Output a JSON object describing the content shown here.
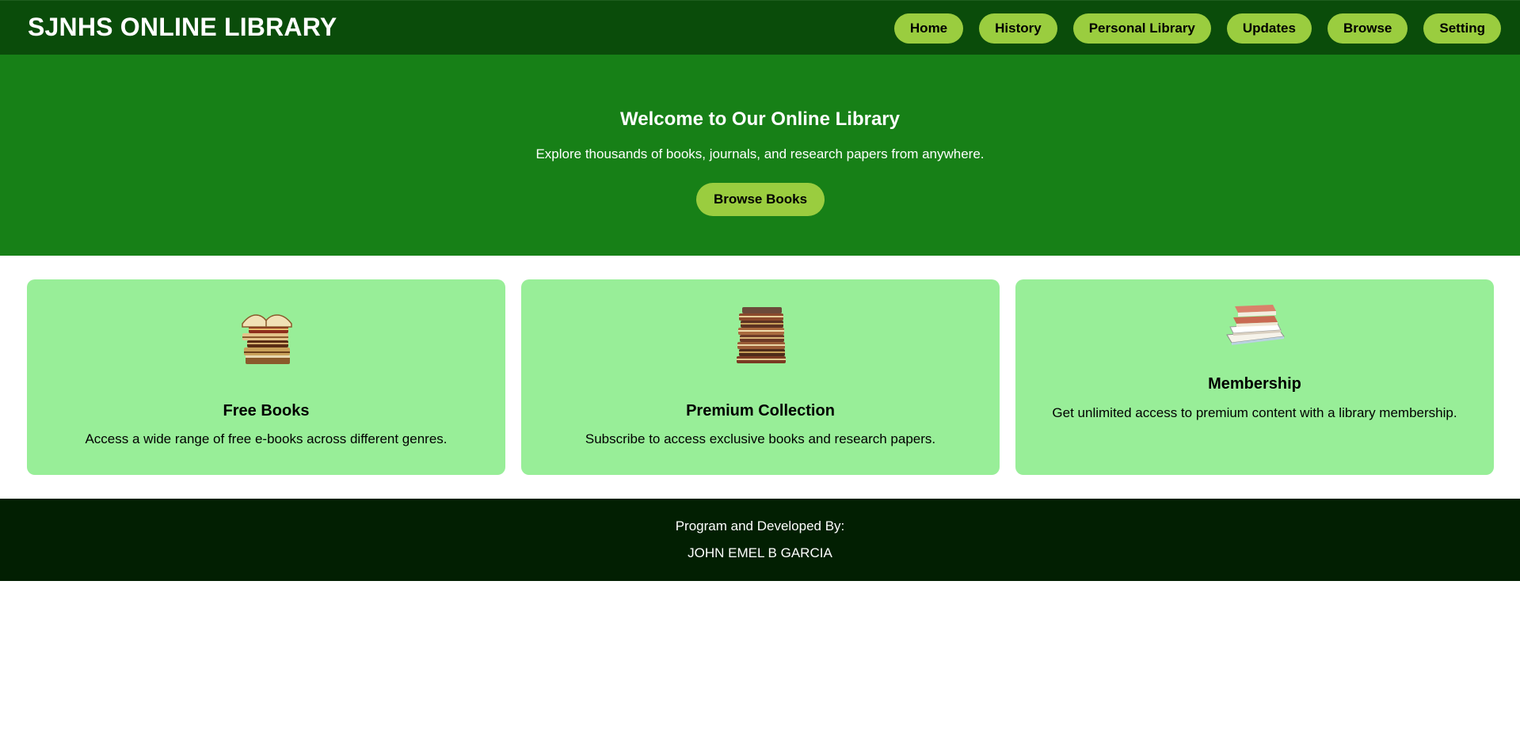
{
  "header": {
    "title": "SJNHS ONLINE LIBRARY",
    "nav": [
      {
        "label": "Home"
      },
      {
        "label": "History"
      },
      {
        "label": "Personal Library"
      },
      {
        "label": "Updates"
      },
      {
        "label": "Browse"
      },
      {
        "label": "Setting"
      }
    ]
  },
  "hero": {
    "title": "Welcome to Our Online Library",
    "subtitle": "Explore thousands of books, journals, and research papers from anywhere.",
    "button_label": "Browse Books"
  },
  "cards": [
    {
      "icon": "book-stack-icon",
      "title": "Free Books",
      "description": "Access a wide range of free e-books across different genres."
    },
    {
      "icon": "book-stack-icon",
      "title": "Premium Collection",
      "description": "Subscribe to access exclusive books and research papers."
    },
    {
      "icon": "book-stack-icon",
      "title": "Membership",
      "description": "Get unlimited access to premium content with a library membership."
    }
  ],
  "footer": {
    "line1": "Program and Developed By:",
    "line2": "JOHN EMEL B GARCIA"
  },
  "colors": {
    "header_bg": "#0a4c0a",
    "hero_bg": "#178017",
    "accent": "#9acd3f",
    "card_bg": "#98ee98",
    "footer_bg": "#021f02"
  }
}
